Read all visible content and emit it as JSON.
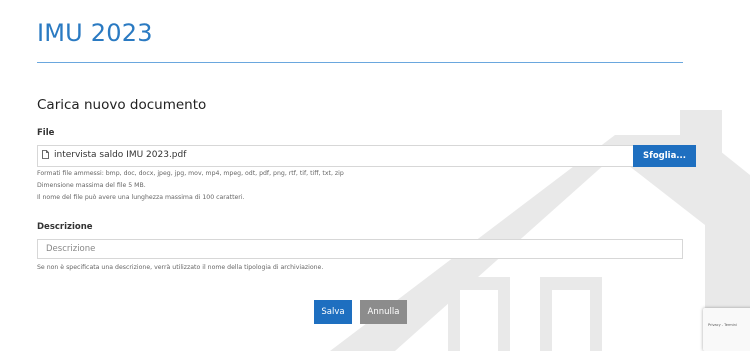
{
  "page": {
    "title": "IMU 2023",
    "section_title": "Carica nuovo documento"
  },
  "file": {
    "label": "File",
    "filename": "intervista saldo IMU 2023.pdf",
    "browse_label": "Sfoglia...",
    "help": [
      "Formati file ammessi: bmp, doc, docx, jpeg, jpg, mov, mp4, mpeg, odt, pdf, png, rtf, tif, tiff, txt, zip",
      "Dimensione massima del file 5 MB.",
      "Il nome del file può avere una lunghezza massima di 100 caratteri."
    ]
  },
  "description": {
    "label": "Descrizione",
    "placeholder": "Descrizione",
    "value": "",
    "help": "Se non è specificata una descrizione, verrà utilizzato il nome della tipologia di archiviazione."
  },
  "actions": {
    "save_label": "Salva",
    "cancel_label": "Annulla"
  },
  "recaptcha": {
    "text": "Privacy - Termini"
  },
  "colors": {
    "accent": "#1e6fc0",
    "title": "#2a7ac2",
    "cancel": "#8c8c8c"
  }
}
